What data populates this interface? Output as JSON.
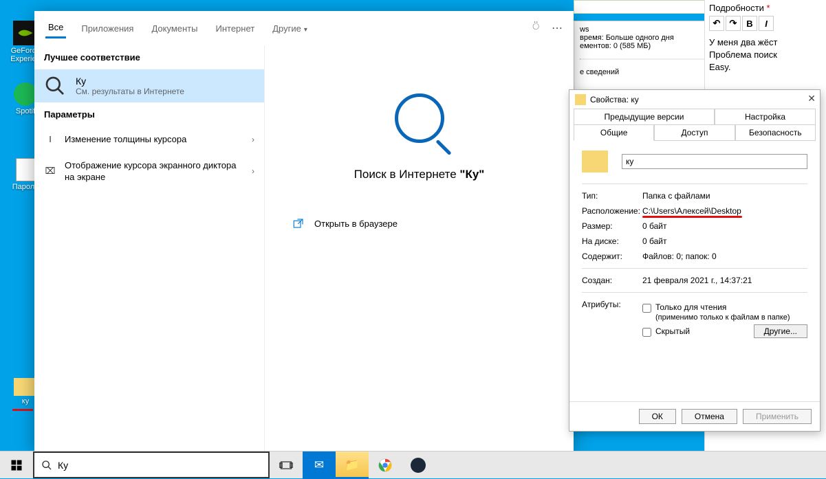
{
  "desktop": {
    "icons": [
      {
        "label": "GeForce Experien",
        "type": "nvidia"
      },
      {
        "label": "Spotif",
        "type": "spotify"
      },
      {
        "label": "Пароли",
        "type": "text"
      },
      {
        "label": "ку",
        "type": "folder"
      }
    ]
  },
  "search": {
    "tabs": [
      "Все",
      "Приложения",
      "Документы",
      "Интернет",
      "Другие"
    ],
    "best_match_header": "Лучшее соответствие",
    "best_title": "Ку",
    "best_sub": "См. результаты в Интернете",
    "params_header": "Параметры",
    "params": [
      {
        "icon": "I",
        "text": "Изменение толщины курсора"
      },
      {
        "icon": "⌧",
        "text": "Отображение курсора экранного диктора на экране"
      }
    ],
    "web_title_prefix": "Поиск в Интернете ",
    "web_title_quoted": "\"Ку\"",
    "open_browser": "Открыть в браузере"
  },
  "props": {
    "title": "Свойства: ку",
    "tabs_row1": [
      "Предыдущие версии",
      "Настройка"
    ],
    "tabs_row2": [
      "Общие",
      "Доступ",
      "Безопасность"
    ],
    "name": "ку",
    "rows": {
      "type_k": "Тип:",
      "type_v": "Папка с файлами",
      "loc_k": "Расположение:",
      "loc_v": "C:\\Users\\Алексей\\Desktop",
      "size_k": "Размер:",
      "size_v": "0 байт",
      "disk_k": "На диске:",
      "disk_v": "0 байт",
      "contain_k": "Содержит:",
      "contain_v": "Файлов: 0; папок: 0",
      "created_k": "Создан:",
      "created_v": "21 февраля 2021 г., 14:37:21",
      "attr_k": "Атрибуты:"
    },
    "attrs": {
      "readonly": "Только для чтения",
      "readonly_note": "(применимо только к файлам в папке)",
      "hidden": "Скрытый",
      "other": "Другие..."
    },
    "buttons": {
      "ok": "ОК",
      "cancel": "Отмена",
      "apply": "Применить"
    }
  },
  "behind": {
    "line1": "ws",
    "line2": "время:  Больше одного дня",
    "line3": "ементов:  0 (585 МБ)",
    "line4": "е сведений"
  },
  "right": {
    "header": "Подробности",
    "text1": "У меня два жёст",
    "text2": "Проблема поиск",
    "text3": "Easy."
  },
  "taskbar": {
    "search_value": "Ку"
  }
}
